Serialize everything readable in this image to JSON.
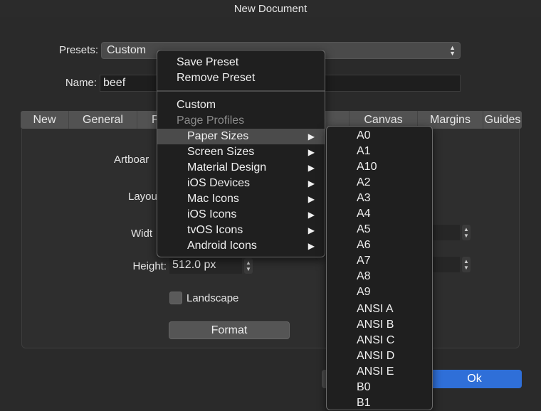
{
  "window": {
    "title": "New Document"
  },
  "form": {
    "presets_label": "Presets:",
    "presets_value": "Custom",
    "name_label": "Name:",
    "name_value": "beef"
  },
  "tabs": [
    "New",
    "General",
    "F",
    "Canvas",
    "Margins",
    "Guides"
  ],
  "panel": {
    "artboard_label": "Artboar",
    "layout_label": "Layou",
    "width_label": "Widt",
    "height_label": "Height:",
    "height_value": "512.0 px",
    "landscape_label": "Landscape",
    "format_button": "Format"
  },
  "footer": {
    "ok_button": "Ok"
  },
  "menu": {
    "save_preset": "Save Preset",
    "remove_preset": "Remove Preset",
    "custom": "Custom",
    "page_profiles": "Page Profiles",
    "items": [
      "Paper Sizes",
      "Screen Sizes",
      "Material Design",
      "iOS Devices",
      "Mac Icons",
      "iOS Icons",
      "tvOS Icons",
      "Android Icons"
    ]
  },
  "submenu": {
    "items": [
      "A0",
      "A1",
      "A10",
      "A2",
      "A3",
      "A4",
      "A5",
      "A6",
      "A7",
      "A8",
      "A9",
      "ANSI A",
      "ANSI B",
      "ANSI C",
      "ANSI D",
      "ANSI E",
      "B0",
      "B1"
    ]
  },
  "colors": {
    "accent": "#2f6fd8",
    "highlight": "#4b4b4b"
  }
}
